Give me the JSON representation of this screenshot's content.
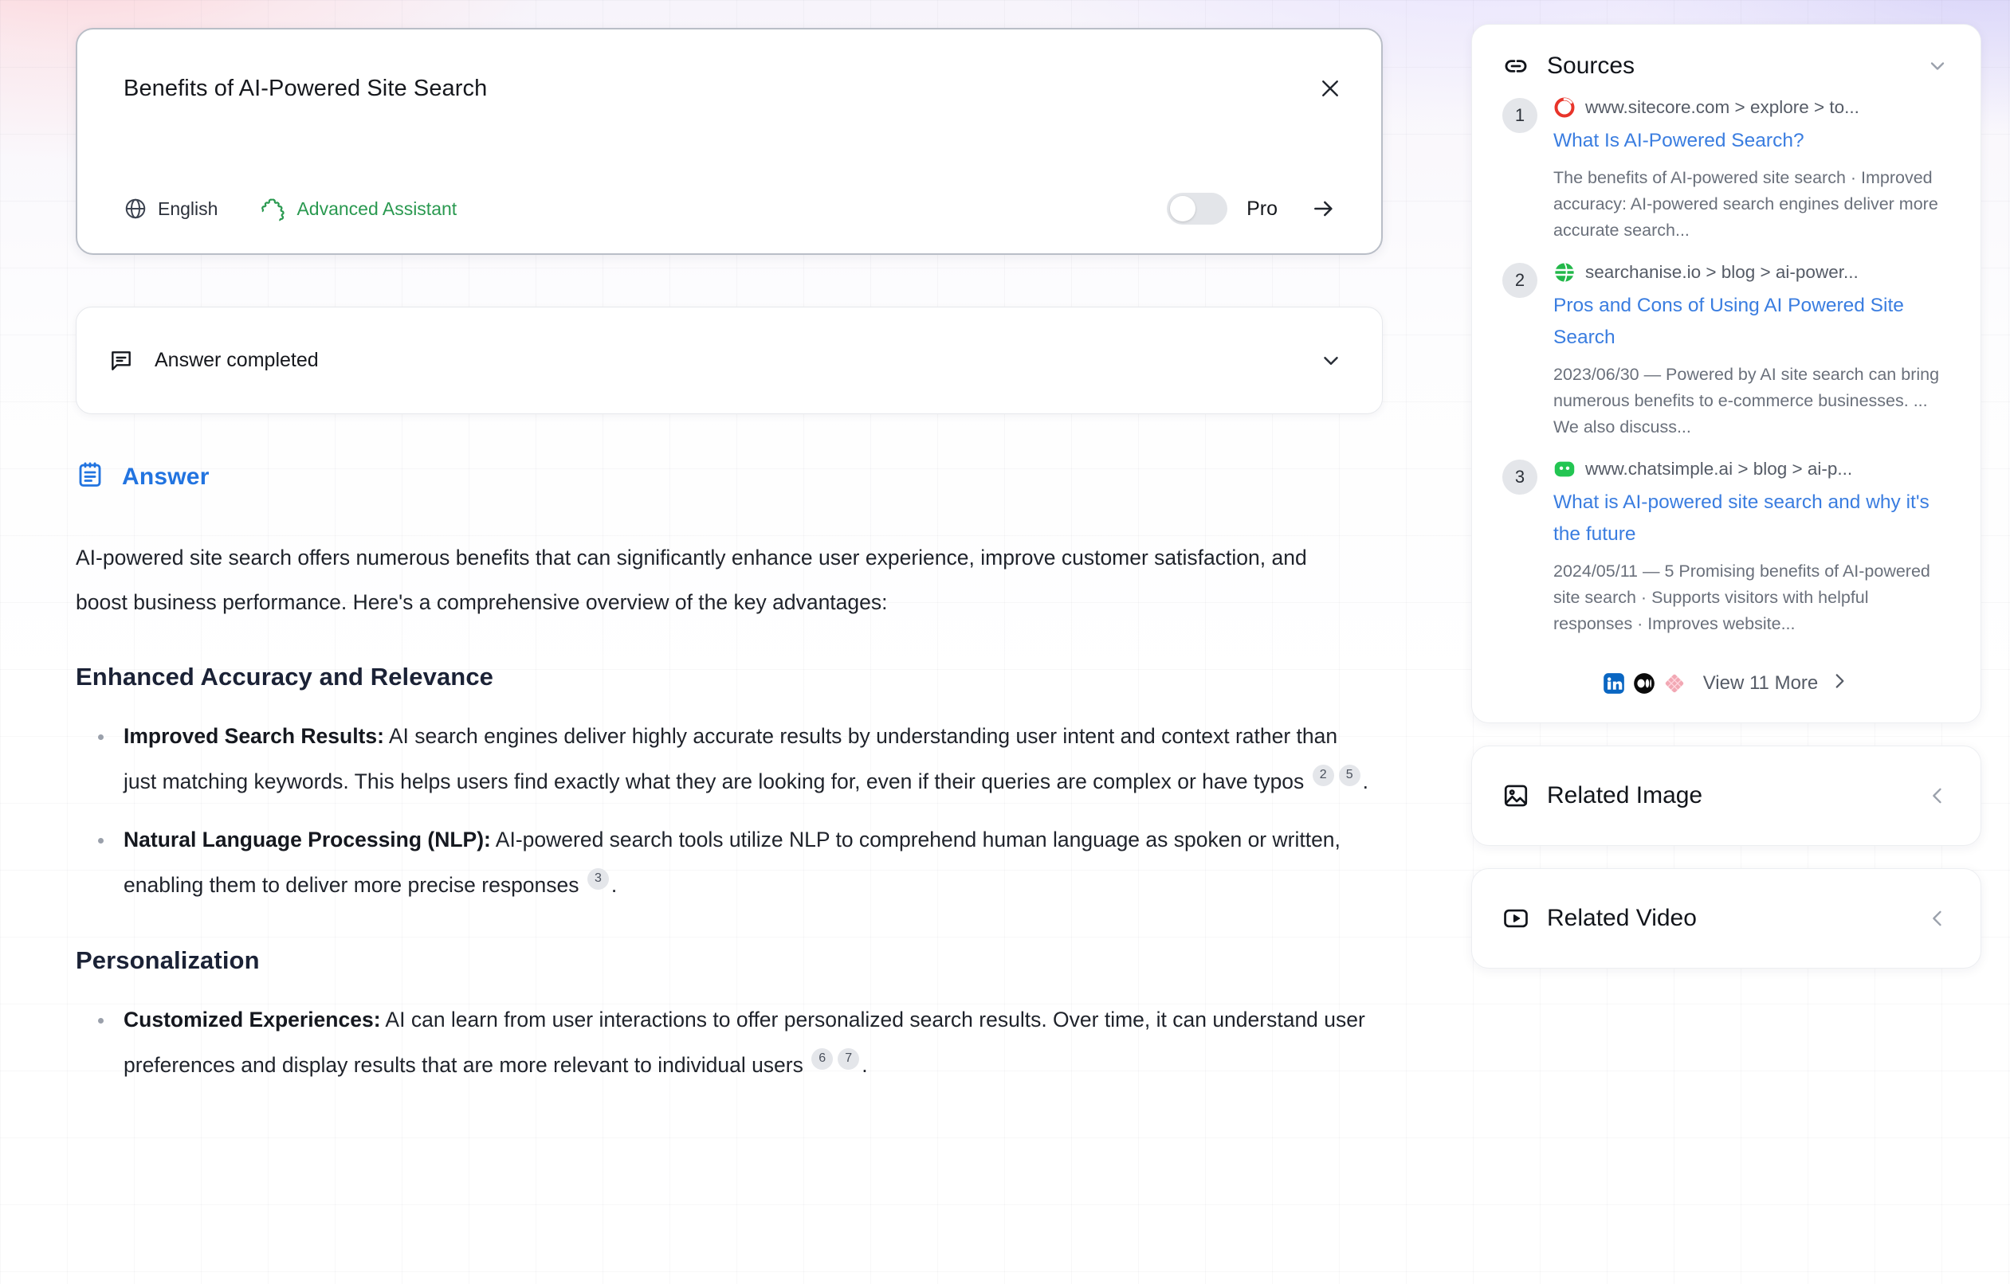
{
  "search": {
    "query": "Benefits of AI-Powered Site Search",
    "close_icon": "close-icon",
    "language": "English",
    "language_icon": "globe-icon",
    "assistant_mode": "Advanced Assistant",
    "assistant_icon": "puzzle-piece-icon",
    "pro_label": "Pro",
    "pro_enabled": false,
    "submit_icon": "arrow-right-icon"
  },
  "status": {
    "icon": "chat-bubble-icon",
    "text": "Answer completed",
    "chevron": "chevron-down-icon"
  },
  "answer": {
    "icon": "notepad-icon",
    "heading": "Answer",
    "intro": "AI-powered site search offers numerous benefits that can significantly enhance user experience, improve customer satisfaction, and boost business performance. Here's a comprehensive overview of the key advantages:",
    "sections": [
      {
        "heading": "Enhanced Accuracy and Relevance",
        "bullets": [
          {
            "lead": "Improved Search Results:",
            "text": " AI search engines deliver highly accurate results by understanding user intent and context rather than just matching keywords. This helps users find exactly what they are looking for, even if their queries are complex or have typos ",
            "citations": [
              "2",
              "5"
            ],
            "tail": "."
          },
          {
            "lead": "Natural Language Processing (NLP):",
            "text": " AI-powered search tools utilize NLP to comprehend human language as spoken or written, enabling them to deliver more precise responses ",
            "citations": [
              "3"
            ],
            "tail": "."
          }
        ]
      },
      {
        "heading": "Personalization",
        "bullets": [
          {
            "lead": "Customized Experiences:",
            "text": " AI can learn from user interactions to offer personalized search results. Over time, it can understand user preferences and display results that are more relevant to individual users ",
            "citations": [
              "6",
              "7"
            ],
            "tail": "."
          }
        ]
      }
    ]
  },
  "sidebar": {
    "sources": {
      "icon": "link-icon",
      "title": "Sources",
      "toggle_icon": "chevron-down-icon",
      "items": [
        {
          "number": "1",
          "favicon": "sitecore-favicon",
          "favicon_color": "#e8342a",
          "url": "www.sitecore.com > explore > to...",
          "title": "What Is AI-Powered Search?",
          "snippet": "The benefits of AI-powered site search · Improved accuracy: AI-powered search engines deliver more accurate search..."
        },
        {
          "number": "2",
          "favicon": "searchanise-favicon",
          "favicon_color": "#23b84a",
          "url": "searchanise.io > blog > ai-power...",
          "title": "Pros and Cons of Using AI Powered Site Search",
          "snippet": "2023/06/30 — Powered by AI site search can bring numerous benefits to e-commerce businesses. ... We also discuss..."
        },
        {
          "number": "3",
          "favicon": "chatsimple-favicon",
          "favicon_color": "#23c552",
          "url": "www.chatsimple.ai > blog > ai-p...",
          "title": "What is AI-powered site search and why it's the future",
          "snippet": "2024/05/11 — 5 Promising benefits of AI-powered site search · Supports visitors with helpful responses · Improves website..."
        }
      ],
      "view_more": {
        "label": "View 11 More",
        "chevron": "chevron-right-icon",
        "favicons": [
          "linkedin-favicon",
          "medium-favicon",
          "diamond-favicon"
        ]
      }
    },
    "related_image": {
      "icon": "image-icon",
      "title": "Related Image",
      "toggle_icon": "chevron-left-icon"
    },
    "related_video": {
      "icon": "video-play-icon",
      "title": "Related Video",
      "toggle_icon": "chevron-left-icon"
    }
  },
  "colors": {
    "accent_blue": "#2274e0",
    "link_blue": "#3a7de0",
    "assistant_green": "#2a9950",
    "heading_navy": "#1b2236"
  }
}
